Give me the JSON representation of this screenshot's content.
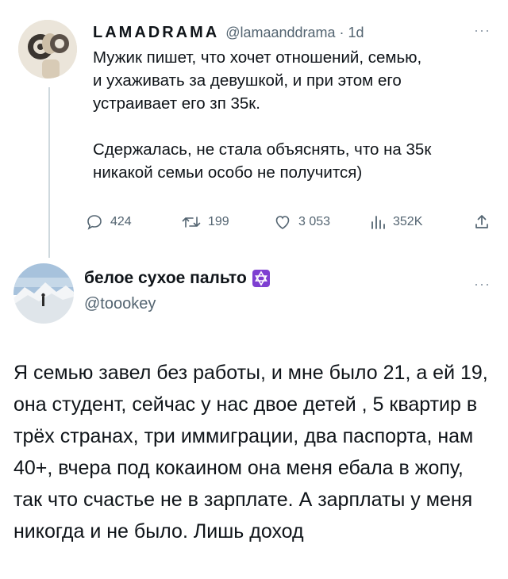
{
  "tweet1": {
    "display_name": "LAMADRAMA",
    "handle_time": "@lamaanddrama · 1d",
    "more_icon": "more-horizontal-icon",
    "text": "Мужик пишет, что хочет отношений, семью,\nи ухаживать за девушкой, и при этом его\nустраивает его зп 35к.\n\nСдержалась, не стала объяснять, что на 35к\nникакой семьи особо не получится)",
    "actions": {
      "replies": "424",
      "retweets": "199",
      "likes": "3 053",
      "views": "352K"
    }
  },
  "tweet2": {
    "display_name": "белое сухое пальто",
    "badge_icon": "star-of-david-icon",
    "handle": "@toookey",
    "more_icon": "more-horizontal-icon",
    "text": "Я семью завел без работы, и мне было 21, а ей 19, она студент, сейчас у нас двое детей , 5 квартир в трёх странах, три иммиграции, два паспорта, нам 40+, вчера под кокаином она меня ебала в жопу, так что счастье не в зарплате. А зарплаты у меня никогда и не было. Лишь доход"
  },
  "colors": {
    "text": "#0f1419",
    "muted": "#536471",
    "thread_line": "#cfd9de",
    "badge": "#7e3fd1"
  }
}
